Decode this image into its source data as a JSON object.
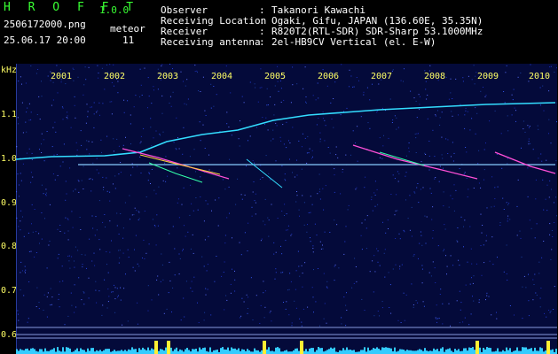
{
  "header": {
    "app_title": "H R O F F T",
    "version": "1.0.0",
    "filename": "2506172000.png",
    "datetime": "25.06.17 20:00",
    "meteor_label": "meteor",
    "meteor_count": "11",
    "rows": [
      {
        "label": "Observer",
        "sep": ":",
        "value": "Takanori Kawachi"
      },
      {
        "label": "Receiving Location",
        "sep": ":",
        "value": "Ogaki, Gifu, JAPAN (136.60E, 35.35N)"
      },
      {
        "label": "Receiver",
        "sep": ":",
        "value": "R820T2(RTL-SDR) SDR-Sharp 53.1000MHz"
      },
      {
        "label": "Receiving antenna",
        "sep": ":",
        "value": "2el-HB9CV Vertical (el. E-W)"
      }
    ]
  },
  "plot": {
    "unit": "kHz",
    "y_ticks": [
      "1.1",
      "1.0",
      "0.9",
      "0.8",
      "0.7",
      "0.6"
    ],
    "x_ticks": [
      "2001",
      "2002",
      "2003",
      "2004",
      "2005",
      "2006",
      "2007",
      "2008",
      "2009",
      "2010"
    ],
    "colors": {
      "background": "#040a3a",
      "label": "#ffff66",
      "trace": "#33ccff",
      "meteor": "#ff4fd8"
    }
  }
}
